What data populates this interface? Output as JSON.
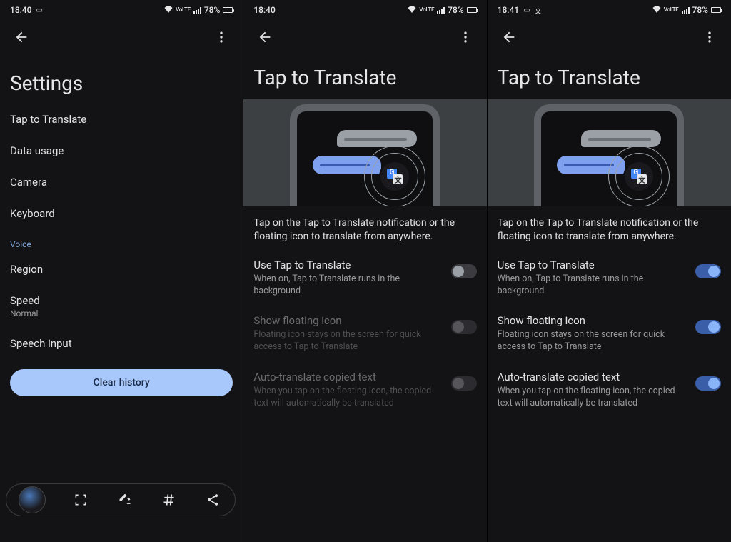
{
  "panel1": {
    "status": {
      "time": "18:40",
      "battery_pct": "78%"
    },
    "title": "Settings",
    "items": [
      {
        "label": "Tap to Translate"
      },
      {
        "label": "Data usage"
      },
      {
        "label": "Camera"
      },
      {
        "label": "Keyboard"
      }
    ],
    "voice_header": "Voice",
    "voice_items": {
      "region": "Region",
      "speed": "Speed",
      "speed_value": "Normal",
      "speech_input": "Speech input"
    },
    "clear_history": "Clear history"
  },
  "panel2": {
    "status": {
      "time": "18:40",
      "battery_pct": "78%"
    },
    "title": "Tap to Translate",
    "description": "Tap on the Tap to Translate notification or the floating icon to translate from anywhere.",
    "options": {
      "use": {
        "title": "Use Tap to Translate",
        "sub": "When on, Tap to Translate runs in the background",
        "on": false,
        "enabled": true
      },
      "floating": {
        "title": "Show floating icon",
        "sub": "Floating icon stays on the screen for quick access to Tap to Translate",
        "on": false,
        "enabled": false
      },
      "auto": {
        "title": "Auto-translate copied text",
        "sub": "When you tap on the floating icon, the copied text will automatically be translated",
        "on": false,
        "enabled": false
      }
    }
  },
  "panel3": {
    "status": {
      "time": "18:41",
      "battery_pct": "78%"
    },
    "title": "Tap to Translate",
    "description": "Tap on the Tap to Translate notification or the floating icon to translate from anywhere.",
    "options": {
      "use": {
        "title": "Use Tap to Translate",
        "sub": "When on, Tap to Translate runs in the background",
        "on": true,
        "enabled": true
      },
      "floating": {
        "title": "Show floating icon",
        "sub": "Floating icon stays on the screen for quick access to Tap to Translate",
        "on": true,
        "enabled": true
      },
      "auto": {
        "title": "Auto-translate copied text",
        "sub": "When you tap on the floating icon, the copied text will automatically be translated",
        "on": true,
        "enabled": true
      }
    }
  }
}
